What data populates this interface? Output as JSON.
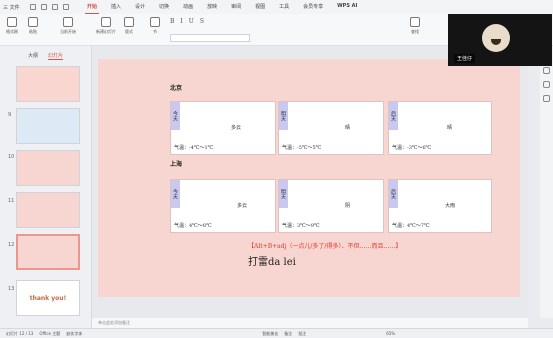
{
  "app": {
    "brand": "三 文件"
  },
  "menu": {
    "tabs": [
      "开始",
      "插入",
      "设计",
      "切换",
      "动画",
      "放映",
      "审阅",
      "视图",
      "工具",
      "会员专享",
      "WPS AI"
    ],
    "active": "开始"
  },
  "ribbon": {
    "groups": [
      "格式刷",
      "粘贴",
      "当前开始",
      "新建幻灯片",
      "版式",
      "节"
    ],
    "replace": "查找",
    "textbox": "文本框",
    "shape": "形状"
  },
  "leftpane": {
    "tabs": [
      "大纲",
      "幻灯片"
    ],
    "active": "幻灯片",
    "thumb_nums": [
      "8",
      "9",
      "10",
      "11",
      "12",
      "13"
    ],
    "thankyou": "thank you!"
  },
  "slide": {
    "city1": "北京",
    "city2": "上海",
    "cards_row1": [
      {
        "day": "今天",
        "cond": "多云",
        "temp": "气温：-4℃～1℃"
      },
      {
        "day": "明天",
        "cond": "晴",
        "temp": "气温：-5℃～5℃"
      },
      {
        "day": "后天",
        "cond": "晴",
        "temp": "气温：-3℃～6℃"
      }
    ],
    "cards_row2": [
      {
        "day": "今天",
        "cond": "多云",
        "temp": "气温：4℃～8℃"
      },
      {
        "day": "明天",
        "cond": "阴",
        "temp": "气温：3℃～9℃"
      },
      {
        "day": "后天",
        "cond": "大雨",
        "temp": "气温：4℃～7℃"
      }
    ],
    "hint": "【Alt+B+adj（一点儿/多了/得多）、不但……而且……】",
    "pinyin": "打雷da lei"
  },
  "notes": "单击此处添加备注",
  "status": {
    "slide": "幻灯片 12 / 13",
    "theme": "Office 主题",
    "font": "缺失字体",
    "beautify": "智能美化",
    "notes": "备注",
    "comment": "批注",
    "zoom": "65%"
  },
  "video": {
    "name": "王佳仔"
  }
}
